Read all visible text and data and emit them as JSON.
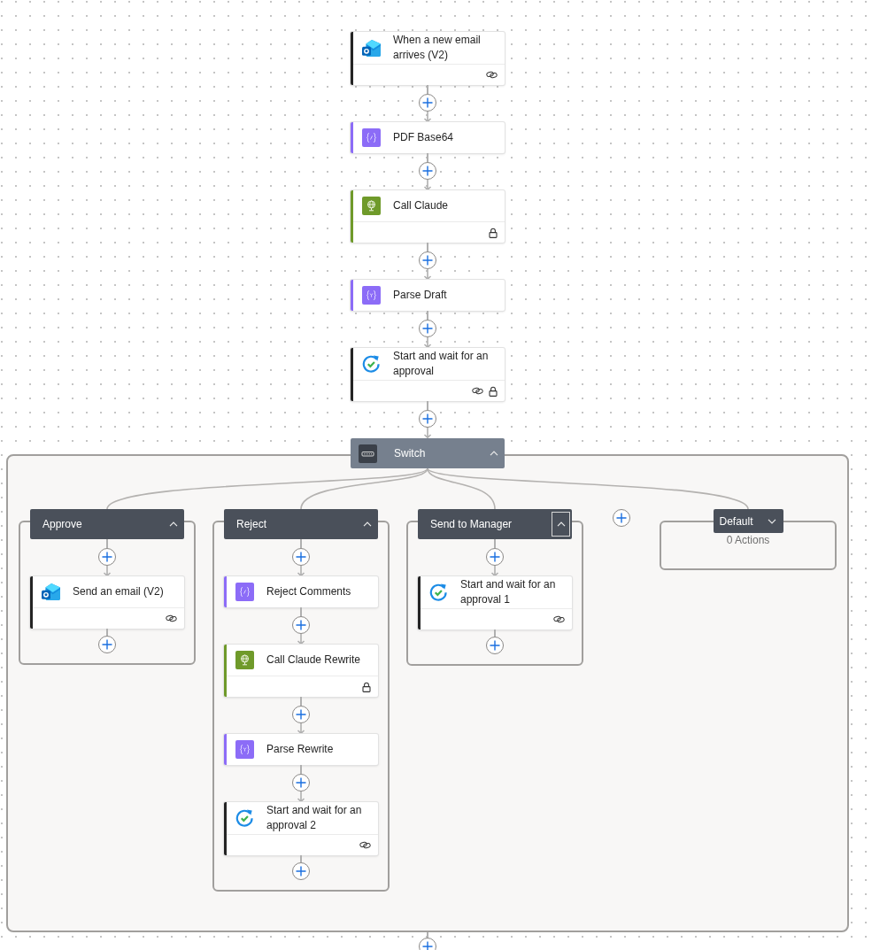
{
  "steps": [
    {
      "kind": "mail",
      "title": "When a new email arrives (V2)",
      "connection": true,
      "secured": false
    },
    {
      "kind": "variable",
      "title": "PDF Base64",
      "connection": false,
      "secured": false
    },
    {
      "kind": "http",
      "title": "Call Claude",
      "connection": false,
      "secured": true
    },
    {
      "kind": "parse",
      "title": "Parse Draft",
      "connection": false,
      "secured": false
    },
    {
      "kind": "approval",
      "title": "Start and wait for an approval",
      "connection": true,
      "secured": true
    }
  ],
  "switch": {
    "title": "Switch",
    "expanded": true,
    "cases": [
      {
        "title": "Approve",
        "expanded": true,
        "focused": false,
        "steps": [
          {
            "kind": "mail",
            "title": "Send an email (V2)",
            "connection": true,
            "secured": false
          }
        ]
      },
      {
        "title": "Reject",
        "expanded": true,
        "focused": false,
        "steps": [
          {
            "kind": "variable",
            "title": "Reject Comments",
            "connection": false,
            "secured": false
          },
          {
            "kind": "http",
            "title": "Call Claude Rewrite",
            "connection": false,
            "secured": true
          },
          {
            "kind": "parse",
            "title": "Parse Rewrite",
            "connection": false,
            "secured": false
          },
          {
            "kind": "approval",
            "title": "Start and wait for an approval 2",
            "connection": true,
            "secured": false
          }
        ]
      },
      {
        "title": "Send to Manager",
        "expanded": true,
        "focused": true,
        "steps": [
          {
            "kind": "approval",
            "title": "Start and wait for an approval 1",
            "connection": true,
            "secured": false
          }
        ]
      }
    ],
    "default": {
      "title": "Default",
      "expanded": false,
      "summary": "0 Actions"
    }
  }
}
